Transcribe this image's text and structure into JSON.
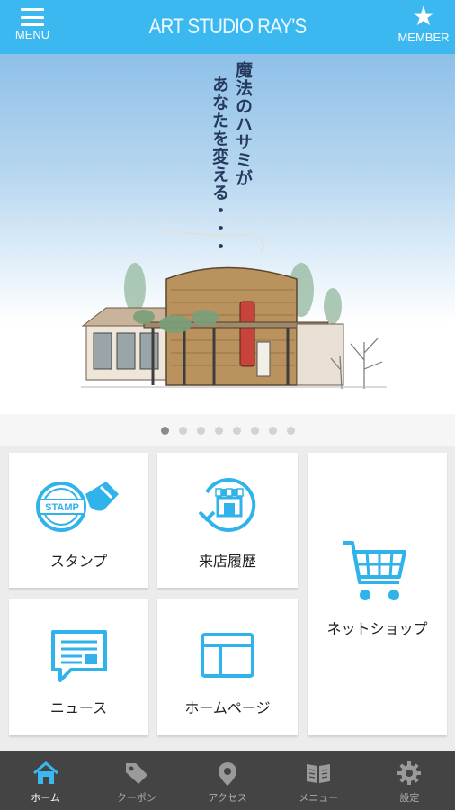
{
  "header": {
    "menu_label": "MENU",
    "app_title": "ART STUDIO RAY'S",
    "member_label": "MEMBER",
    "color": "#3bb8f0"
  },
  "hero": {
    "tagline_line1": "魔法のハサミが",
    "tagline_line2": "あなたを変える・・・",
    "slide_count": 8,
    "active_slide": 1
  },
  "tiles": {
    "stamp": {
      "label": "スタンプ",
      "icon": "stamp-icon"
    },
    "visit_history": {
      "label": "来店履歴",
      "icon": "shop-history-icon"
    },
    "net_shop": {
      "label": "ネットショップ",
      "icon": "cart-icon"
    },
    "news": {
      "label": "ニュース",
      "icon": "news-icon"
    },
    "homepage": {
      "label": "ホームページ",
      "icon": "browser-window-icon"
    },
    "accent_color": "#2fb3ea"
  },
  "bottom_nav": {
    "items": [
      {
        "label": "ホーム",
        "icon": "home-icon",
        "active": true
      },
      {
        "label": "クーポン",
        "icon": "tag-icon",
        "active": false
      },
      {
        "label": "アクセス",
        "icon": "map-pin-icon",
        "active": false
      },
      {
        "label": "メニュー",
        "icon": "book-icon",
        "active": false
      },
      {
        "label": "設定",
        "icon": "gear-icon",
        "active": false
      }
    ],
    "active_color": "#3bb8f0"
  }
}
